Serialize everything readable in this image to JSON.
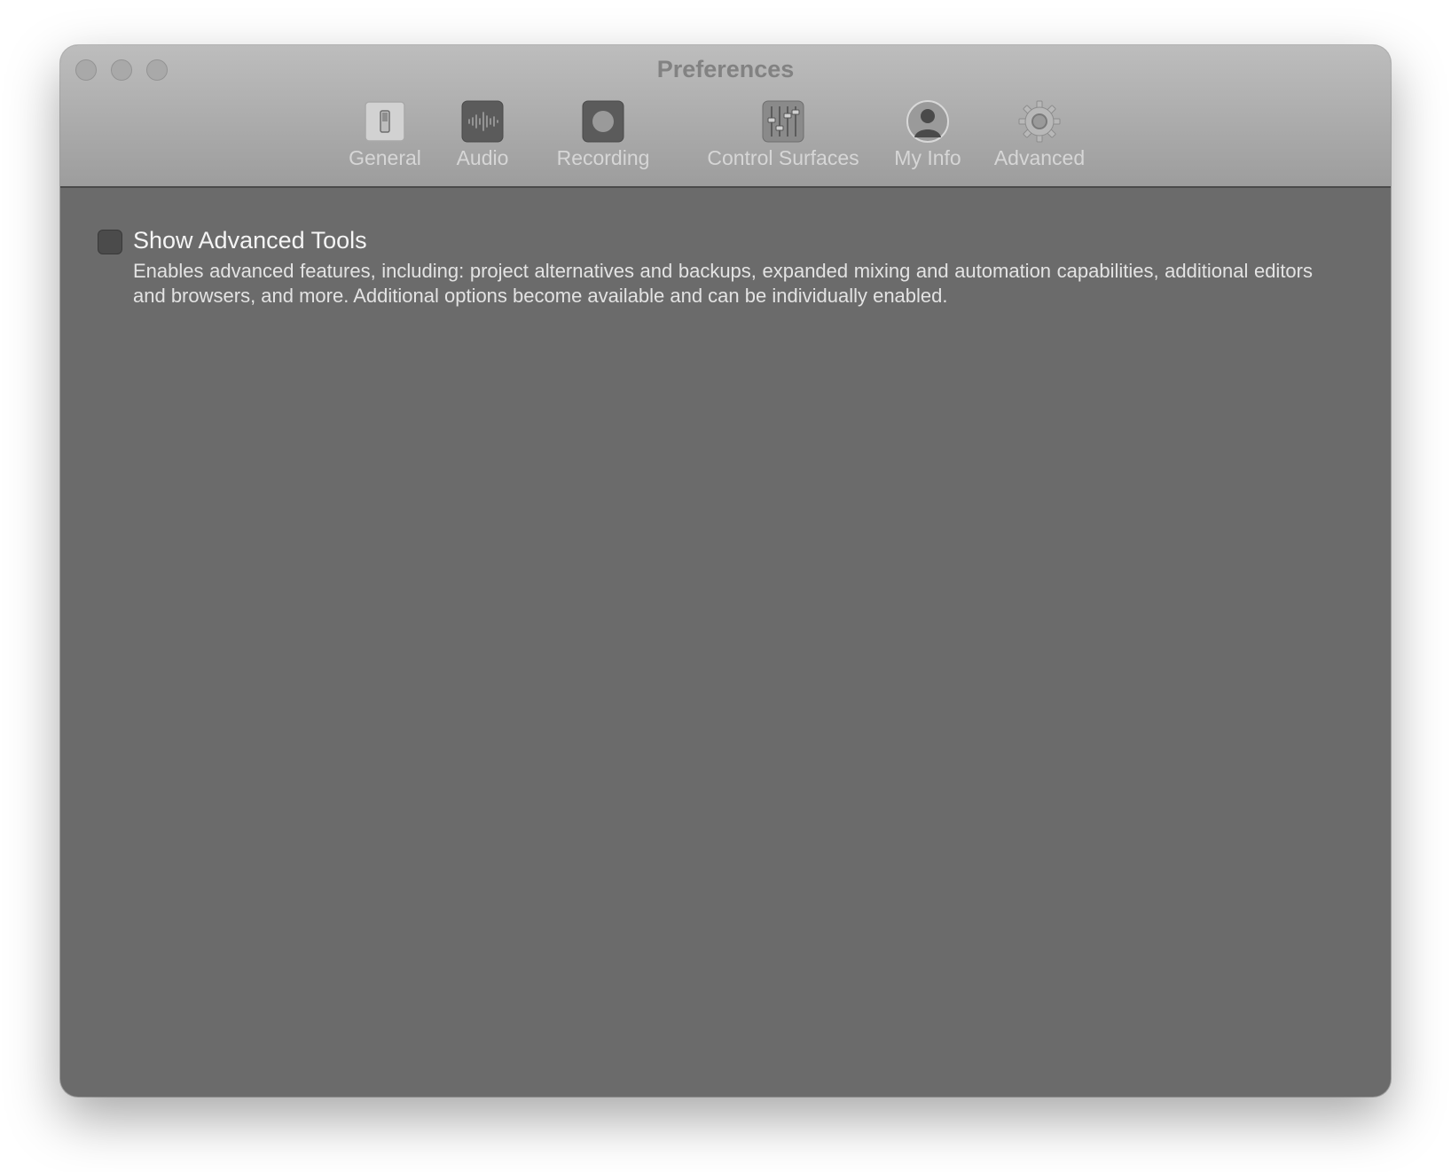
{
  "window": {
    "title": "Preferences"
  },
  "toolbar": {
    "tabs": [
      {
        "label": "General",
        "icon": "switch-icon"
      },
      {
        "label": "Audio",
        "icon": "waveform-icon"
      },
      {
        "label": "Recording",
        "icon": "record-icon"
      },
      {
        "label": "Control Surfaces",
        "icon": "faders-icon"
      },
      {
        "label": "My Info",
        "icon": "person-icon"
      },
      {
        "label": "Advanced",
        "icon": "gear-icon"
      }
    ],
    "selected": "Advanced"
  },
  "advanced": {
    "show_advanced_tools": {
      "label": "Show Advanced Tools",
      "checked": false,
      "description": "Enables advanced features, including: project alternatives and backups, expanded mixing and automation capabilities, additional editors and browsers, and more. Additional options become available and can be individually enabled."
    }
  }
}
